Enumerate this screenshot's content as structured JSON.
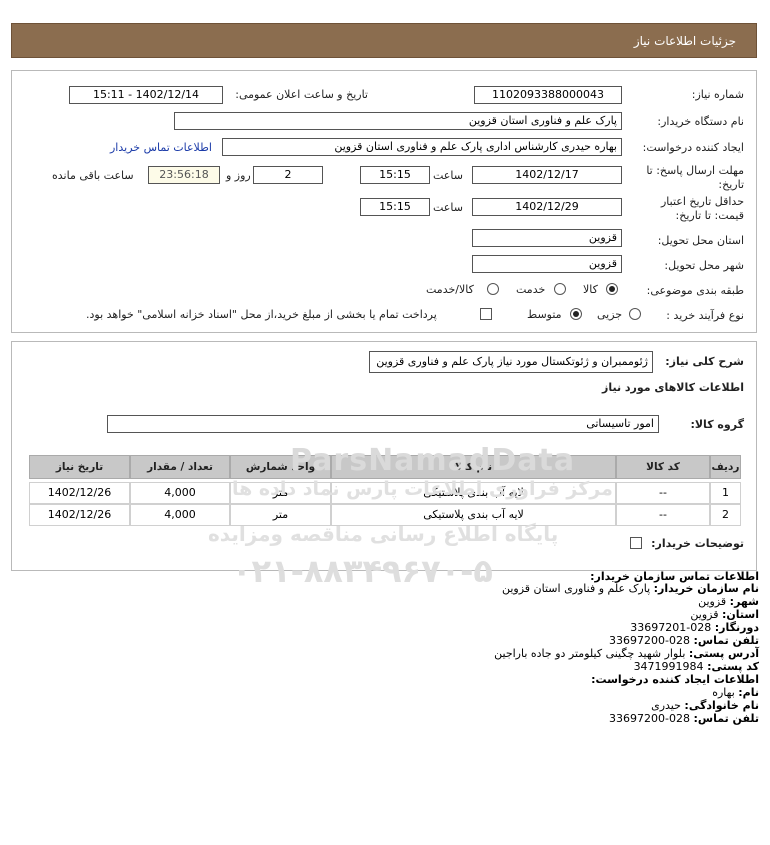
{
  "header": {
    "title": "جزئیات اطلاعات نیاز"
  },
  "form": {
    "need_number_label": "شماره نیاز:",
    "need_number": "1102093388000043",
    "announce_label": "تاریخ و ساعت اعلان عمومی:",
    "announce_value": "1402/12/14 - 15:11",
    "buyer_org_label": "نام دستگاه خریدار:",
    "buyer_org": "پارک علم و فناوری استان قزوین",
    "creator_label": "ایجاد کننده درخواست:",
    "creator": "بهاره حیدری کارشناس اداری پارک علم و فناوری استان قزوین",
    "contact_link": "اطلاعات تماس خریدار",
    "reply_deadline_label_1": "مهلت ارسال پاسخ: تا",
    "reply_deadline_label_2": "تاریخ:",
    "reply_date": "1402/12/17",
    "time_label": "ساعت",
    "reply_time": "15:15",
    "days_value": "2",
    "days_label": "روز و",
    "remaining_time": "23:56:18",
    "remaining_label": "ساعت باقی مانده",
    "price_validity_label_1": "حداقل تاریخ اعتبار",
    "price_validity_label_2": "قیمت: تا تاریخ:",
    "validity_date": "1402/12/29",
    "validity_time": "15:15",
    "province_label": "استان محل تحویل:",
    "province": "قزوین",
    "city_label": "شهر محل تحویل:",
    "city": "قزوین",
    "category_label": "طبقه بندی موضوعی:",
    "category_options": [
      "کالا",
      "خدمت",
      "کالا/خدمت"
    ],
    "process_label": "نوع فرآیند خرید :",
    "process_options": [
      "جزیی",
      "متوسط"
    ],
    "payment_note": "پرداخت تمام یا بخشی از مبلغ خرید،از محل \"اسناد خزانه اسلامی\" خواهد بود."
  },
  "details": {
    "summary_label": "شرح کلی نیاز:",
    "summary": "ژئوممبران و ژئوتکستال مورد نیاز پارک علم و فناوری قزوین",
    "goods_info_label": "اطلاعات کالاهای مورد نیاز",
    "goods_group_label": "گروه کالا:",
    "goods_group": "امور تاسیساتی",
    "table": {
      "headers": [
        "ردیف",
        "کد کالا",
        "نام کالا",
        "واحد شمارش",
        "تعداد / مقدار",
        "تاریخ نیاز"
      ],
      "rows": [
        [
          "1",
          "--",
          "لایه آب بندی پلاستیکی",
          "متر",
          "4,000",
          "1402/12/26"
        ],
        [
          "2",
          "--",
          "لایه آب بندی پلاستیکی",
          "متر",
          "4,000",
          "1402/12/26"
        ]
      ]
    },
    "buyer_notes_label": "توضیحات خریدار:"
  },
  "contact": {
    "title": "اطلاعات تماس سازمان خریدار:",
    "org_label": "نام سازمان خریدار:",
    "org": "پارک علم و فناوری استان قزوین",
    "city_label": "شهر:",
    "city": "قزوین",
    "province_label": "استان:",
    "province": "قزوین",
    "fax_label": "دورنگار:",
    "fax": "028-33697201",
    "phone_label": "تلفن تماس:",
    "phone": "028-33697200",
    "address_label": "آدرس پستی:",
    "address": "بلوار شهید چگینی کیلومتر دو جاده باراجین",
    "postal_label": "کد پستی:",
    "postal": "3471991984",
    "creator_title": "اطلاعات ایجاد کننده درخواست:",
    "name_label": "نام:",
    "name": "بهاره",
    "family_label": "نام خانوادگی:",
    "family": "حیدری",
    "creator_phone_label": "تلفن تماس:",
    "creator_phone": "028-33697200"
  },
  "watermark": {
    "brand": "ParsNamadData",
    "line1": "مرکز فراوری اطلاعات پارس نماد داده ها",
    "line2": "پایگاه اطلاع رسانی مناقصه ومزایده",
    "phone": "۰۲۱-۸۸۳۴۹۶۷۰-۵"
  }
}
